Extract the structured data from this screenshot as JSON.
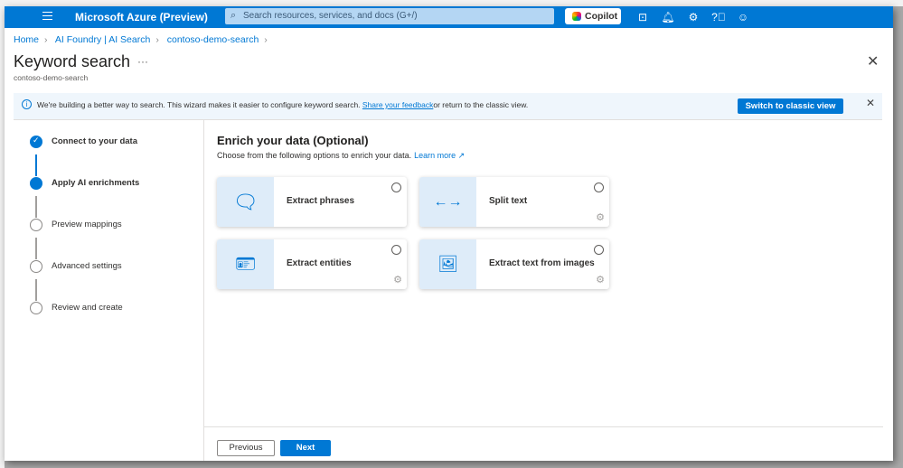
{
  "topbar": {
    "title": "Microsoft Azure (Preview)",
    "search_placeholder": "Search resources, services, and docs (G+/)",
    "copilot": "Copilot"
  },
  "breadcrumb": [
    "Home",
    "AI Foundry | AI Search",
    "contoso-demo-search"
  ],
  "page": {
    "title": "Keyword search",
    "subtitle": "contoso-demo-search",
    "more": "···"
  },
  "info": {
    "text": "We're building a better way to search. This wizard makes it easier to configure keyword search. ",
    "link": "Share your feedback",
    "text2": "or return to the classic view.",
    "button": "Switch to classic view"
  },
  "steps": [
    {
      "label": "Connect to your data",
      "state": "done"
    },
    {
      "label": "Apply AI enrichments",
      "state": "current"
    },
    {
      "label": "Preview mappings",
      "state": "pending"
    },
    {
      "label": "Advanced settings",
      "state": "pending"
    },
    {
      "label": "Review and create",
      "state": "pending"
    }
  ],
  "main": {
    "heading": "Enrich your data (Optional)",
    "description": "Choose from the following options to enrich your data.",
    "learn_more": "Learn more ↗",
    "cards": [
      {
        "label": "Extract phrases",
        "icon": "comment-icon",
        "selected": false
      },
      {
        "label": "Split text",
        "icon": "split-arrows-icon",
        "selected": false
      },
      {
        "label": "Extract entities",
        "icon": "contact-card-icon",
        "selected": false
      },
      {
        "label": "Extract text from images",
        "icon": "image-icon",
        "selected": false
      }
    ]
  },
  "footer": {
    "previous": "Previous",
    "next": "Next"
  },
  "colors": {
    "accent": "#0078d4",
    "panel": "#deecf9",
    "info_bg": "#eff6fc"
  }
}
